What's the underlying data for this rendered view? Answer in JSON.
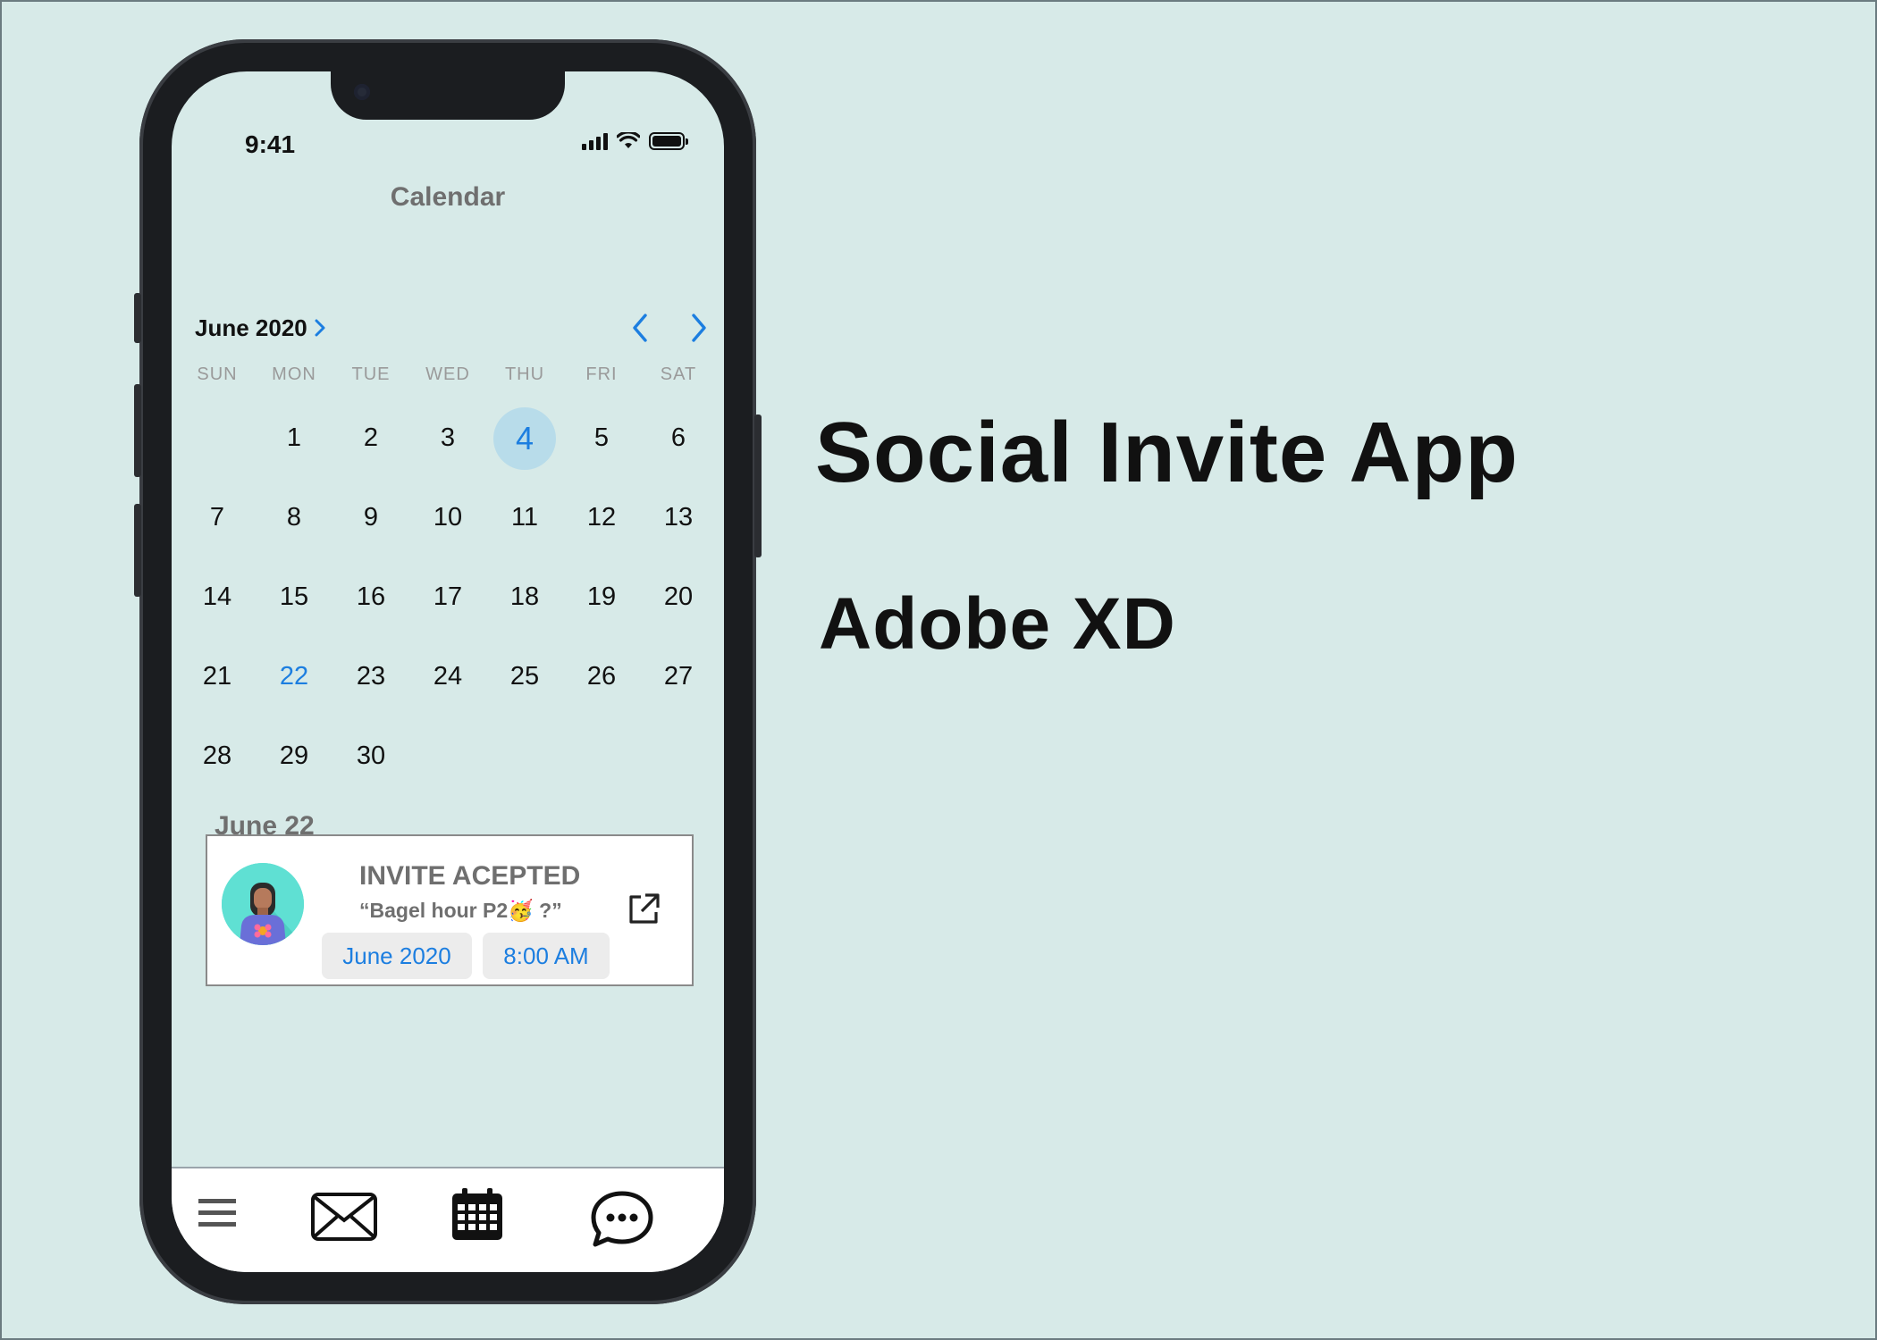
{
  "status": {
    "time": "9:41"
  },
  "header": {
    "title": "Calendar"
  },
  "calendar": {
    "month_label": "June 2020",
    "weekdays": [
      "SUN",
      "MON",
      "TUE",
      "WED",
      "THU",
      "FRI",
      "SAT"
    ],
    "days": [
      "",
      "1",
      "2",
      "3",
      "4",
      "5",
      "6",
      "7",
      "8",
      "9",
      "10",
      "11",
      "12",
      "13",
      "14",
      "15",
      "16",
      "17",
      "18",
      "19",
      "20",
      "21",
      "22",
      "23",
      "24",
      "25",
      "26",
      "27",
      "28",
      "29",
      "30",
      "",
      "",
      "",
      ""
    ],
    "today": "4",
    "selected": "22"
  },
  "event": {
    "date_heading": "June 22",
    "title": "INVITE ACEPTED",
    "message": "“Bagel hour P2🥳 ?”",
    "date_chip": "June 2020",
    "time_chip": "8:00 AM"
  },
  "tabbar": {
    "items": [
      "menu-icon",
      "mail-icon",
      "calendar-icon",
      "chat-icon"
    ]
  },
  "promo": {
    "title": "Social Invite App",
    "subtitle": "Adobe XD"
  },
  "colors": {
    "accent": "#1c7ee0",
    "background": "#d7eae8",
    "today_circle": "#b8dcea"
  }
}
